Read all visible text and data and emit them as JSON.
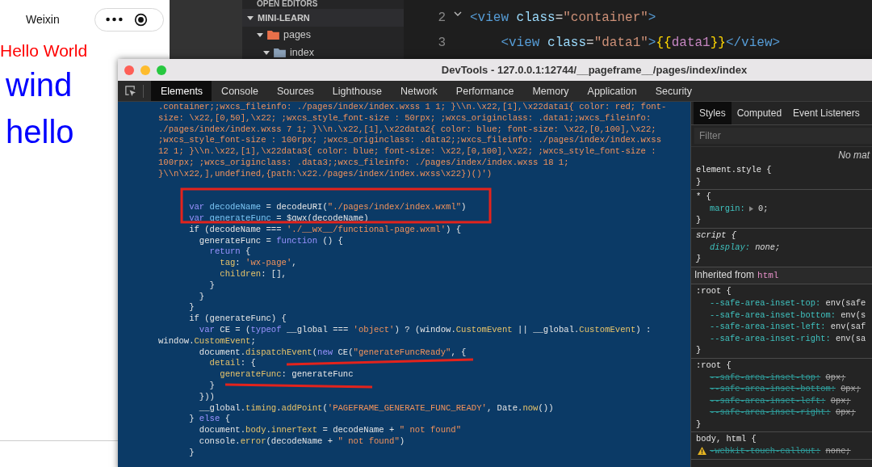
{
  "simulator": {
    "title": "Weixin",
    "texts": [
      {
        "text": "Hello World",
        "kind": "small",
        "color": "#ff0000"
      },
      {
        "text": "wind",
        "kind": "large",
        "color": "#0000ff"
      },
      {
        "text": "hello",
        "kind": "large",
        "color": "#0000ff"
      }
    ]
  },
  "explorer": {
    "section": "OPEN EDITORS",
    "project": "MINI-LEARN",
    "project_expanded": true,
    "tree": [
      {
        "label": "pages",
        "expanded": true,
        "color": "#e8704a",
        "children": [
          {
            "label": "index",
            "expanded": true,
            "color": "#8aa0b8"
          }
        ]
      }
    ]
  },
  "editor": {
    "lines": [
      {
        "number": "2",
        "folded_marker": true,
        "tokens": [
          {
            "kind": "tag",
            "text": "<view"
          },
          {
            "kind": "attr",
            "text": " class"
          },
          {
            "kind": "plain",
            "text": "="
          },
          {
            "kind": "string",
            "text": "\"container\""
          },
          {
            "kind": "tag",
            "text": ">"
          }
        ]
      },
      {
        "number": "3",
        "folded_marker": false,
        "tokens": [
          {
            "kind": "tag",
            "text": "    <view"
          },
          {
            "kind": "attr",
            "text": " class"
          },
          {
            "kind": "plain",
            "text": "="
          },
          {
            "kind": "string",
            "text": "\"data1\""
          },
          {
            "kind": "tag",
            "text": ">"
          },
          {
            "kind": "brace",
            "text": "{{"
          },
          {
            "kind": "ident",
            "text": "data1"
          },
          {
            "kind": "brace",
            "text": "}}"
          },
          {
            "kind": "tag",
            "text": "</view>"
          }
        ]
      }
    ]
  },
  "devtools": {
    "title": "DevTools - 127.0.0.1:12744/__pageframe__/pages/index/index",
    "tabs": [
      {
        "label": "Elements",
        "selected": true
      },
      {
        "label": "Console",
        "selected": false
      },
      {
        "label": "Sources",
        "selected": false
      },
      {
        "label": "Lighthouse",
        "selected": false
      },
      {
        "label": "Network",
        "selected": false
      },
      {
        "label": "Performance",
        "selected": false
      },
      {
        "label": "Memory",
        "selected": false
      },
      {
        "label": "Application",
        "selected": false
      },
      {
        "label": "Security",
        "selected": false
      }
    ],
    "code_lines": [
      {
        "kind": "code",
        "tokens": [
          {
            "kind": "string",
            "text": ".container;;wxcs_fileinfo: ./pages/index/index.wxss 1 1; }\\\\n.\\x22,[1],\\x22data1{ color: red; font-"
          }
        ]
      },
      {
        "kind": "code",
        "tokens": [
          {
            "kind": "string",
            "text": "size: \\x22,[0,50],\\x22; ;wxcs_style_font-size : 50rpx; ;wxcs_originclass: .data1;;wxcs_fileinfo:"
          }
        ]
      },
      {
        "kind": "code",
        "tokens": [
          {
            "kind": "string",
            "text": "./pages/index/index.wxss 7 1; }\\\\n.\\x22,[1],\\x22data2{ color: blue; font-size: \\x22,[0,100],\\x22;"
          }
        ]
      },
      {
        "kind": "code",
        "tokens": [
          {
            "kind": "string",
            "text": ";wxcs_style_font-size : 100rpx; ;wxcs_originclass: .data2;;wxcs_fileinfo: ./pages/index/index.wxss"
          }
        ]
      },
      {
        "kind": "code",
        "tokens": [
          {
            "kind": "string",
            "text": "12 1; }\\\\n.\\x22,[1],\\x22data3{ color: blue; font-size: \\x22,[0,100],\\x22; ;wxcs_style_font-size :"
          }
        ]
      },
      {
        "kind": "code",
        "tokens": [
          {
            "kind": "string",
            "text": "100rpx; ;wxcs_originclass: .data3;;wxcs_fileinfo: ./pages/index/index.wxss 18 1;"
          }
        ]
      },
      {
        "kind": "code",
        "tokens": [
          {
            "kind": "string",
            "text": "}\\\\n\\x22,],undefined,{path:\\x22./pages/index/index.wxss\\x22})()')"
          }
        ]
      },
      {
        "kind": "blank"
      },
      {
        "kind": "blank"
      },
      {
        "kind": "code",
        "tokens": [
          {
            "kind": "keyword",
            "text": "      var"
          },
          {
            "kind": "variable",
            "text": " decodeName"
          },
          {
            "kind": "plain",
            "text": " = decodeURI("
          },
          {
            "kind": "string",
            "text": "\"./pages/index/index.wxml\""
          },
          {
            "kind": "plain",
            "text": ")"
          }
        ]
      },
      {
        "kind": "code",
        "tokens": [
          {
            "kind": "keyword",
            "text": "      var"
          },
          {
            "kind": "variable",
            "text": " generateFunc"
          },
          {
            "kind": "plain",
            "text": " = $gwx(decodeName)"
          }
        ]
      },
      {
        "kind": "code",
        "tokens": [
          {
            "kind": "plain",
            "text": "      if (decodeName === "
          },
          {
            "kind": "string",
            "text": "'./__wx__/functional-page.wxml'"
          },
          {
            "kind": "plain",
            "text": ") {"
          }
        ]
      },
      {
        "kind": "code",
        "tokens": [
          {
            "kind": "plain",
            "text": "        generateFunc = "
          },
          {
            "kind": "keyword",
            "text": "function"
          },
          {
            "kind": "plain",
            "text": " () {"
          }
        ]
      },
      {
        "kind": "code",
        "tokens": [
          {
            "kind": "keyword",
            "text": "          return"
          },
          {
            "kind": "plain",
            "text": " {"
          }
        ]
      },
      {
        "kind": "code",
        "tokens": [
          {
            "kind": "property",
            "text": "            tag"
          },
          {
            "kind": "plain",
            "text": ": "
          },
          {
            "kind": "string",
            "text": "'wx-page'"
          },
          {
            "kind": "plain",
            "text": ","
          }
        ]
      },
      {
        "kind": "code",
        "tokens": [
          {
            "kind": "property",
            "text": "            children"
          },
          {
            "kind": "plain",
            "text": ": [],"
          }
        ]
      },
      {
        "kind": "code",
        "tokens": [
          {
            "kind": "plain",
            "text": "          }"
          }
        ]
      },
      {
        "kind": "code",
        "tokens": [
          {
            "kind": "plain",
            "text": "        }"
          }
        ]
      },
      {
        "kind": "code",
        "tokens": [
          {
            "kind": "plain",
            "text": "      }"
          }
        ]
      },
      {
        "kind": "code",
        "tokens": [
          {
            "kind": "plain",
            "text": "      if (generateFunc) {"
          }
        ]
      },
      {
        "kind": "code",
        "tokens": [
          {
            "kind": "keyword",
            "text": "        var"
          },
          {
            "kind": "plain",
            "text": " CE = ("
          },
          {
            "kind": "keyword",
            "text": "typeof"
          },
          {
            "kind": "plain",
            "text": " __global === "
          },
          {
            "kind": "string",
            "text": "'object'"
          },
          {
            "kind": "plain",
            "text": ") ? (window."
          },
          {
            "kind": "property",
            "text": "CustomEvent"
          },
          {
            "kind": "plain",
            "text": " || __global."
          },
          {
            "kind": "property",
            "text": "CustomEvent"
          },
          {
            "kind": "plain",
            "text": ") :"
          }
        ]
      },
      {
        "kind": "code",
        "tokens": [
          {
            "kind": "plain",
            "text": "window."
          },
          {
            "kind": "property",
            "text": "CustomEvent"
          },
          {
            "kind": "plain",
            "text": ";"
          }
        ]
      },
      {
        "kind": "code",
        "tokens": [
          {
            "kind": "plain",
            "text": "        document."
          },
          {
            "kind": "property",
            "text": "dispatchEvent"
          },
          {
            "kind": "plain",
            "text": "("
          },
          {
            "kind": "keyword",
            "text": "new"
          },
          {
            "kind": "plain",
            "text": " CE("
          },
          {
            "kind": "string",
            "text": "\"generateFuncReady\""
          },
          {
            "kind": "plain",
            "text": ", {"
          }
        ]
      },
      {
        "kind": "code",
        "tokens": [
          {
            "kind": "property",
            "text": "          detail"
          },
          {
            "kind": "plain",
            "text": ": {"
          }
        ]
      },
      {
        "kind": "code",
        "tokens": [
          {
            "kind": "property",
            "text": "            generateFunc"
          },
          {
            "kind": "plain",
            "text": ": generateFunc"
          }
        ]
      },
      {
        "kind": "code",
        "tokens": [
          {
            "kind": "plain",
            "text": "          }"
          }
        ]
      },
      {
        "kind": "code",
        "tokens": [
          {
            "kind": "plain",
            "text": "        }))"
          }
        ]
      },
      {
        "kind": "code",
        "tokens": [
          {
            "kind": "plain",
            "text": "        __global."
          },
          {
            "kind": "property",
            "text": "timing"
          },
          {
            "kind": "plain",
            "text": "."
          },
          {
            "kind": "property",
            "text": "addPoint"
          },
          {
            "kind": "plain",
            "text": "("
          },
          {
            "kind": "string",
            "text": "'PAGEFRAME_GENERATE_FUNC_READY'"
          },
          {
            "kind": "plain",
            "text": ", Date."
          },
          {
            "kind": "property",
            "text": "now"
          },
          {
            "kind": "plain",
            "text": "())"
          }
        ]
      },
      {
        "kind": "code",
        "tokens": [
          {
            "kind": "plain",
            "text": "      } "
          },
          {
            "kind": "keyword",
            "text": "else"
          },
          {
            "kind": "plain",
            "text": " {"
          }
        ]
      },
      {
        "kind": "code",
        "tokens": [
          {
            "kind": "plain",
            "text": "        document."
          },
          {
            "kind": "property",
            "text": "body"
          },
          {
            "kind": "plain",
            "text": "."
          },
          {
            "kind": "property",
            "text": "innerText"
          },
          {
            "kind": "plain",
            "text": " = decodeName + "
          },
          {
            "kind": "string",
            "text": "\" not found\""
          }
        ]
      },
      {
        "kind": "code",
        "tokens": [
          {
            "kind": "plain",
            "text": "        console."
          },
          {
            "kind": "property",
            "text": "error"
          },
          {
            "kind": "plain",
            "text": "(decodeName + "
          },
          {
            "kind": "string",
            "text": "\" not found\""
          },
          {
            "kind": "plain",
            "text": ")"
          }
        ]
      },
      {
        "kind": "code",
        "tokens": [
          {
            "kind": "plain",
            "text": "      }"
          }
        ]
      }
    ],
    "styles": {
      "tabs": [
        {
          "label": "Styles",
          "selected": true
        },
        {
          "label": "Computed",
          "selected": false
        },
        {
          "label": "Event Listeners",
          "selected": false
        }
      ],
      "filter": {
        "placeholder": "Filter"
      },
      "message": "No mat",
      "sections": [
        {
          "kind": "rule",
          "selector": "element.style {",
          "italic": false,
          "closing": "}"
        },
        {
          "kind": "rule",
          "selector": "* {",
          "italic": false,
          "closing": "}",
          "declarations": [
            {
              "name": "margin:",
              "value": "0;",
              "expandable": true,
              "struck": false,
              "warning": false
            }
          ]
        },
        {
          "kind": "rule",
          "selector": "script {",
          "italic": true,
          "closing": "}",
          "declarations": [
            {
              "name": "display:",
              "value": "none;",
              "expandable": false,
              "struck": false,
              "warning": false
            }
          ]
        },
        {
          "kind": "inherited",
          "label": "Inherited from",
          "element": "html"
        },
        {
          "kind": "rule",
          "selector": ":root {",
          "italic": false,
          "closing": "}",
          "declarations": [
            {
              "name": "--safe-area-inset-top:",
              "value": "env(safe",
              "expandable": false,
              "struck": false,
              "warning": false
            },
            {
              "name": "--safe-area-inset-bottom:",
              "value": "env(s",
              "expandable": false,
              "struck": false,
              "warning": false
            },
            {
              "name": "--safe-area-inset-left:",
              "value": "env(saf",
              "expandable": false,
              "struck": false,
              "warning": false
            },
            {
              "name": "--safe-area-inset-right:",
              "value": "env(sa",
              "expandable": false,
              "struck": false,
              "warning": false
            }
          ]
        },
        {
          "kind": "rule",
          "selector": ":root {",
          "italic": false,
          "closing": "}",
          "declarations": [
            {
              "name": "--safe-area-inset-top:",
              "value": "0px;",
              "expandable": false,
              "struck": true,
              "warning": false
            },
            {
              "name": "--safe-area-inset-bottom:",
              "value": "0px;",
              "expandable": false,
              "struck": true,
              "warning": false
            },
            {
              "name": "--safe-area-inset-left:",
              "value": "0px;",
              "expandable": false,
              "struck": true,
              "warning": false
            },
            {
              "name": "--safe-area-inset-right:",
              "value": "0px;",
              "expandable": false,
              "struck": true,
              "warning": false
            }
          ]
        },
        {
          "kind": "rule",
          "selector": "body, html {",
          "italic": false,
          "declarations": [
            {
              "name": "-webkit-touch-callout:",
              "value": "none;",
              "expandable": false,
              "struck": true,
              "warning": true
            }
          ]
        }
      ]
    }
  }
}
